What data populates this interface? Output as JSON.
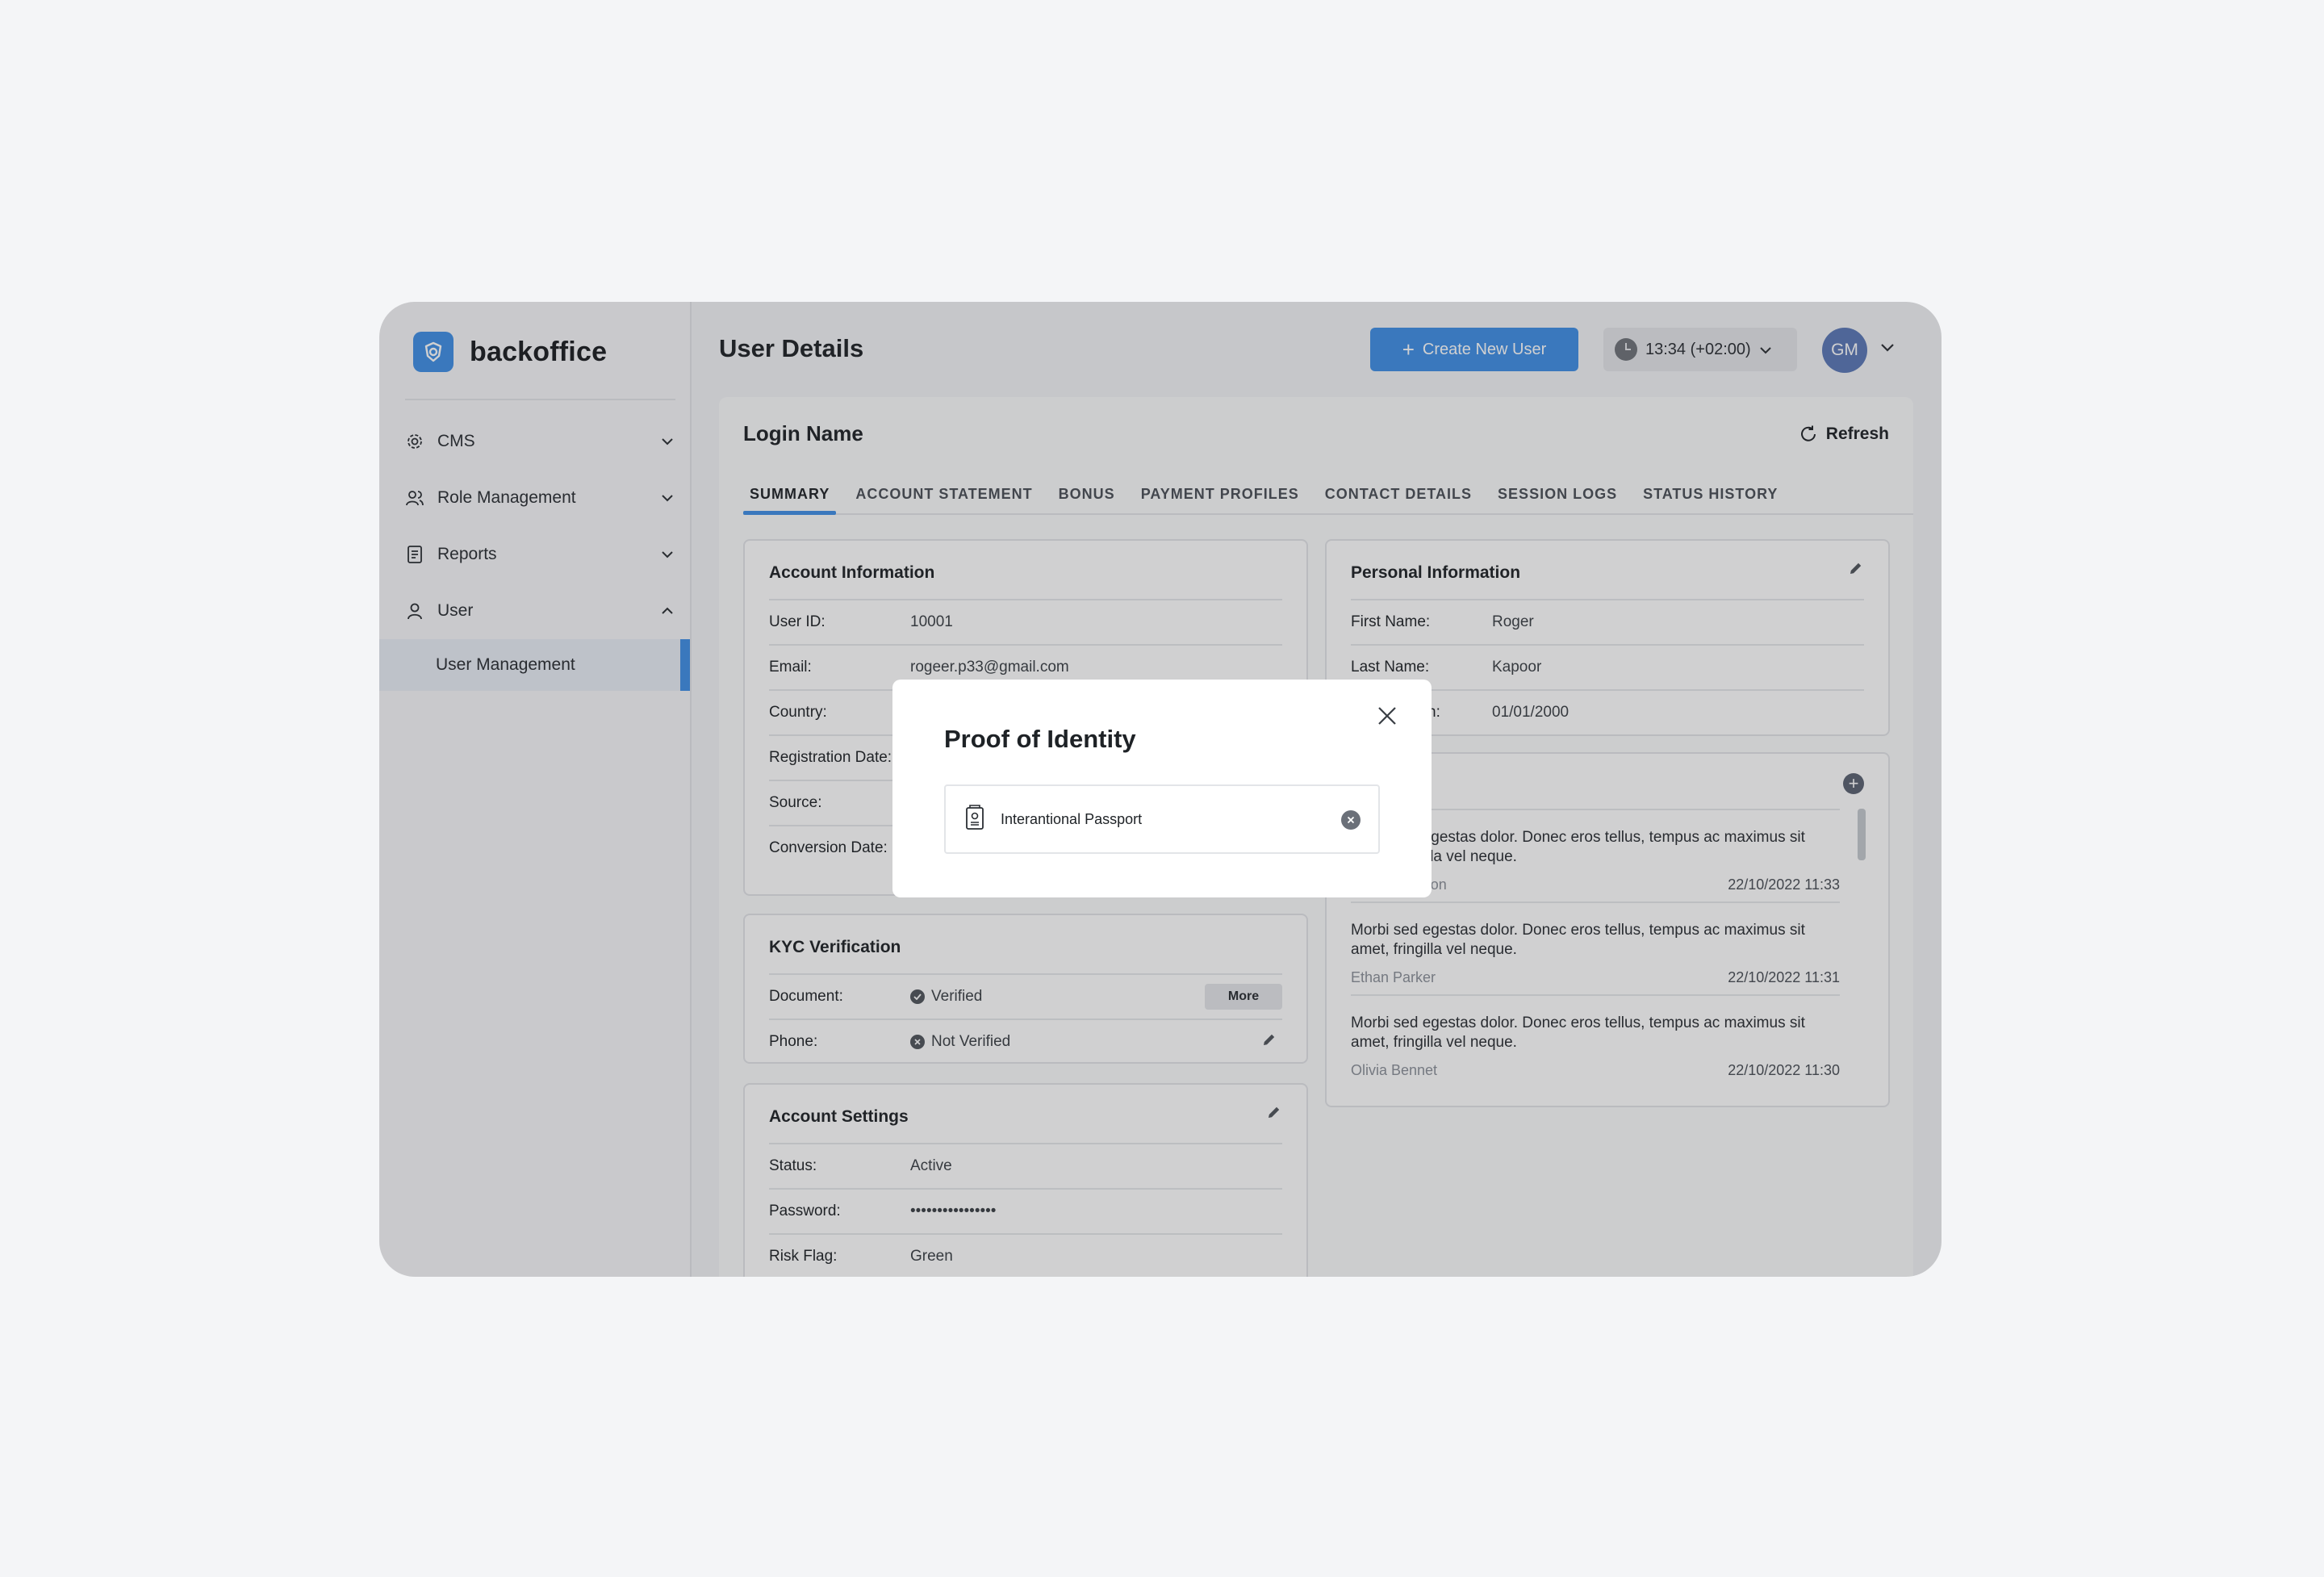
{
  "brand": {
    "name": "backoffice"
  },
  "sidebar": {
    "items": [
      {
        "label": "CMS",
        "icon": "gear-icon",
        "expanded": false
      },
      {
        "label": "Role Management",
        "icon": "users-icon",
        "expanded": false
      },
      {
        "label": "Reports",
        "icon": "report-icon",
        "expanded": false
      },
      {
        "label": "User",
        "icon": "user-icon",
        "expanded": true
      }
    ],
    "sub_items": [
      {
        "label": "User Management",
        "active": true
      }
    ]
  },
  "header": {
    "title": "User Details",
    "create_button": "Create New User",
    "time": "13:34 (+02:00)",
    "avatar_initials": "GM"
  },
  "main": {
    "section_title": "Login Name",
    "refresh_label": "Refresh",
    "tabs": [
      "SUMMARY",
      "ACCOUNT STATEMENT",
      "BONUS",
      "PAYMENT PROFILES",
      "CONTACT DETAILS",
      "SESSION LOGS",
      "STATUS HISTORY"
    ],
    "active_tab": "SUMMARY"
  },
  "account_info": {
    "title": "Account Information",
    "rows": [
      {
        "key": "User ID:",
        "value": "10001"
      },
      {
        "key": "Email:",
        "value": "rogeer.p33@gmail.com"
      },
      {
        "key": "Country:",
        "value": ""
      },
      {
        "key": "Registration Date:",
        "value": ""
      },
      {
        "key": "Source:",
        "value": ""
      },
      {
        "key": "Conversion Date:",
        "value": ""
      }
    ]
  },
  "kyc": {
    "title": "KYC Verification",
    "rows": [
      {
        "key": "Document:",
        "value": "Verified",
        "action": "More"
      },
      {
        "key": "Phone:",
        "value": "Not Verified"
      }
    ]
  },
  "account_settings": {
    "title": "Account Settings",
    "rows": [
      {
        "key": "Status:",
        "value": "Active"
      },
      {
        "key": "Password:",
        "value": "••••••••••••••••"
      },
      {
        "key": "Risk Flag:",
        "value": "Green"
      }
    ]
  },
  "personal_info": {
    "title": "Personal Information",
    "rows": [
      {
        "key": "First Name:",
        "value": "Roger"
      },
      {
        "key": "Last Name:",
        "value": "Kapoor"
      },
      {
        "key": "Date of Birth:",
        "value": "01/01/2000"
      }
    ]
  },
  "notes": {
    "items": [
      {
        "text": "Morbi sed egestas dolor. Donec eros tellus, tempus ac maximus sit amet, fringilla vel neque.",
        "author": "Mia Thompson",
        "date": "22/10/2022 11:33"
      },
      {
        "text": "Morbi sed egestas dolor. Donec eros tellus, tempus ac maximus sit amet, fringilla vel neque.",
        "author": "Ethan Parker",
        "date": "22/10/2022 11:31"
      },
      {
        "text": "Morbi sed egestas dolor. Donec eros tellus, tempus ac maximus sit amet, fringilla vel neque.",
        "author": "Olivia Bennet",
        "date": "22/10/2022 11:30"
      }
    ]
  },
  "modal": {
    "title": "Proof of Identity",
    "documents": [
      {
        "label": "Interantional Passport",
        "icon": "passport-icon"
      }
    ]
  },
  "colors": {
    "accent": "#3f8fe6",
    "avatar": "#5a78b6",
    "overlay": "rgba(40,40,44,0.22)"
  }
}
